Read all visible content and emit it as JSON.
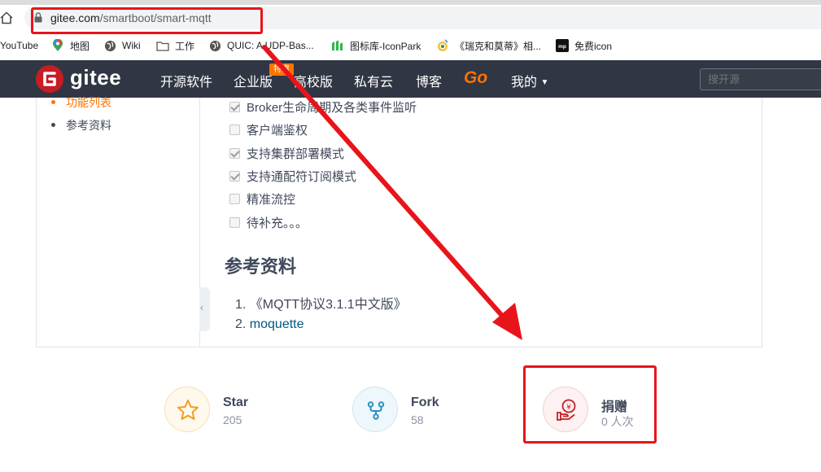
{
  "browser": {
    "url_host": "gitee.com",
    "url_path": "/smartboot/smart-mqtt",
    "bookmarks": [
      {
        "label": "YouTube",
        "icon": "youtube-icon"
      },
      {
        "label": "地图",
        "icon": "maps-pin-icon"
      },
      {
        "label": "Wiki",
        "icon": "globe-icon"
      },
      {
        "label": "工作",
        "icon": "folder-icon"
      },
      {
        "label": "QUIC: A UDP-Bas...",
        "icon": "globe-icon"
      },
      {
        "label": "图标库-IconPark",
        "icon": "iconpark-icon"
      },
      {
        "label": "《瑞克和莫蒂》相...",
        "icon": "douban-icon"
      },
      {
        "label": "免费icon",
        "icon": "mp-icon"
      }
    ]
  },
  "nav": {
    "logo": "gitee",
    "items": [
      "开源软件",
      "企业版",
      "高校版",
      "私有云",
      "博客"
    ],
    "promo_badge": "特惠",
    "go": "Go",
    "mine": "我的",
    "search_placeholder": "搜开源"
  },
  "sidebar": {
    "active": "功能列表",
    "item": "参考资料"
  },
  "features": [
    {
      "label": "Broker生命周期及各类事件监听",
      "checked": true
    },
    {
      "label": "客户端鉴权",
      "checked": false
    },
    {
      "label": "支持集群部署模式",
      "checked": true
    },
    {
      "label": "支持通配符订阅模式",
      "checked": true
    },
    {
      "label": "精准流控",
      "checked": false
    },
    {
      "label": "待补充。。。",
      "checked": false
    }
  ],
  "references": {
    "heading": "参考资料",
    "items": [
      {
        "num": "1.",
        "text": "《MQTT协议3.1.1中文版》"
      },
      {
        "num": "2.",
        "text": "moquette"
      }
    ]
  },
  "stats": {
    "star": {
      "label": "Star",
      "count": "205"
    },
    "fork": {
      "label": "Fork",
      "count": "58"
    },
    "donate": {
      "label": "捐赠",
      "count": "0 人次"
    }
  },
  "colors": {
    "nav_bg": "#303643",
    "brand": "#c71d23",
    "accent": "#fe7300",
    "annotation": "#e8141a"
  }
}
